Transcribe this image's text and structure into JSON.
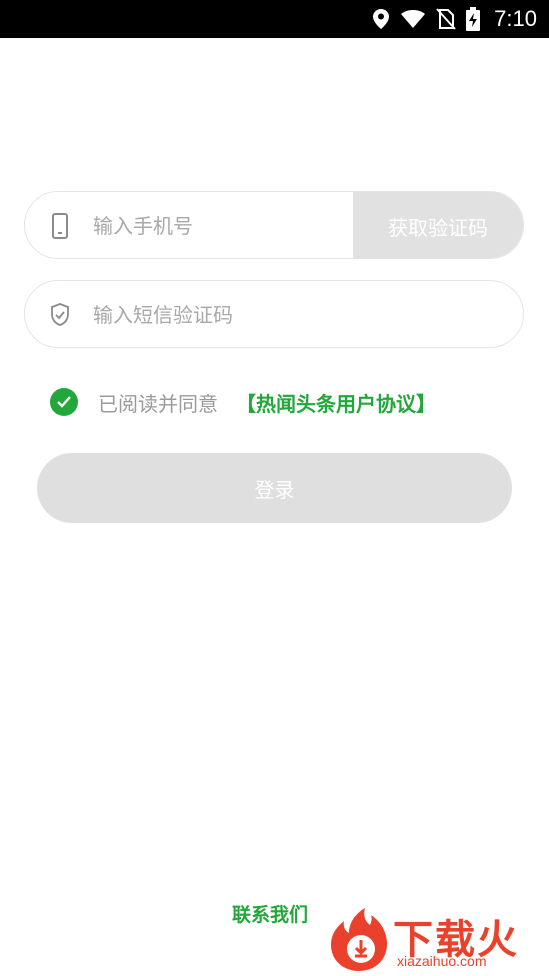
{
  "status_bar": {
    "time": "7:10"
  },
  "form": {
    "phone_placeholder": "输入手机号",
    "get_code_label": "获取验证码",
    "code_placeholder": "输入短信验证码",
    "agree_text": "已阅读并同意",
    "agreement_link": "【热闻头条用户协议】",
    "login_label": "登录"
  },
  "footer": {
    "contact_label": "联系我们",
    "watermark_brand": "下载火",
    "watermark_url": "xiazaihuo.com"
  },
  "colors": {
    "accent": "#22a83a",
    "disabled": "#dfdfdf",
    "placeholder": "#a8a8a8",
    "watermark": "#e9412b"
  },
  "icons": [
    "location-icon",
    "wifi-icon",
    "no-sim-icon",
    "battery-charging-icon",
    "phone-icon",
    "shield-icon",
    "check-icon"
  ]
}
